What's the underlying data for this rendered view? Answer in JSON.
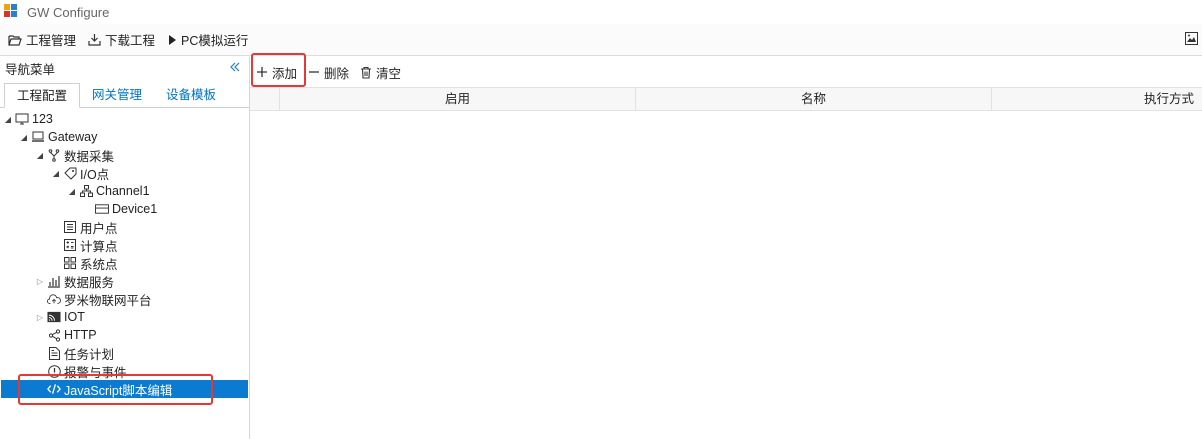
{
  "app": {
    "title": "GW Configure"
  },
  "toolbar": {
    "project_manage": "工程管理",
    "download_project": "下载工程",
    "pc_simulate": "PC模拟运行"
  },
  "nav": {
    "title": "导航菜单",
    "tabs": [
      "工程配置",
      "网关管理",
      "设备模板"
    ],
    "tree": {
      "root": "123",
      "gateway": "Gateway",
      "data_collection": "数据采集",
      "io_points": "I/O点",
      "channel": "Channel1",
      "device": "Device1",
      "user_points": "用户点",
      "calc_points": "计算点",
      "system_points": "系统点",
      "data_service": "数据服务",
      "iot_platform": "罗米物联网平台",
      "iot": "IOT",
      "http": "HTTP",
      "task_plan": "任务计划",
      "alarm_event": "报警与事件",
      "js_editor": "JavaScript脚本编辑"
    }
  },
  "main": {
    "add_label": "添加",
    "delete_label": "删除",
    "clear_label": "清空",
    "columns": [
      "启用",
      "名称",
      "执行方式"
    ]
  },
  "colors": {
    "accent": "#0a7bd1",
    "link": "#0073c4",
    "highlight": "#e53935"
  }
}
